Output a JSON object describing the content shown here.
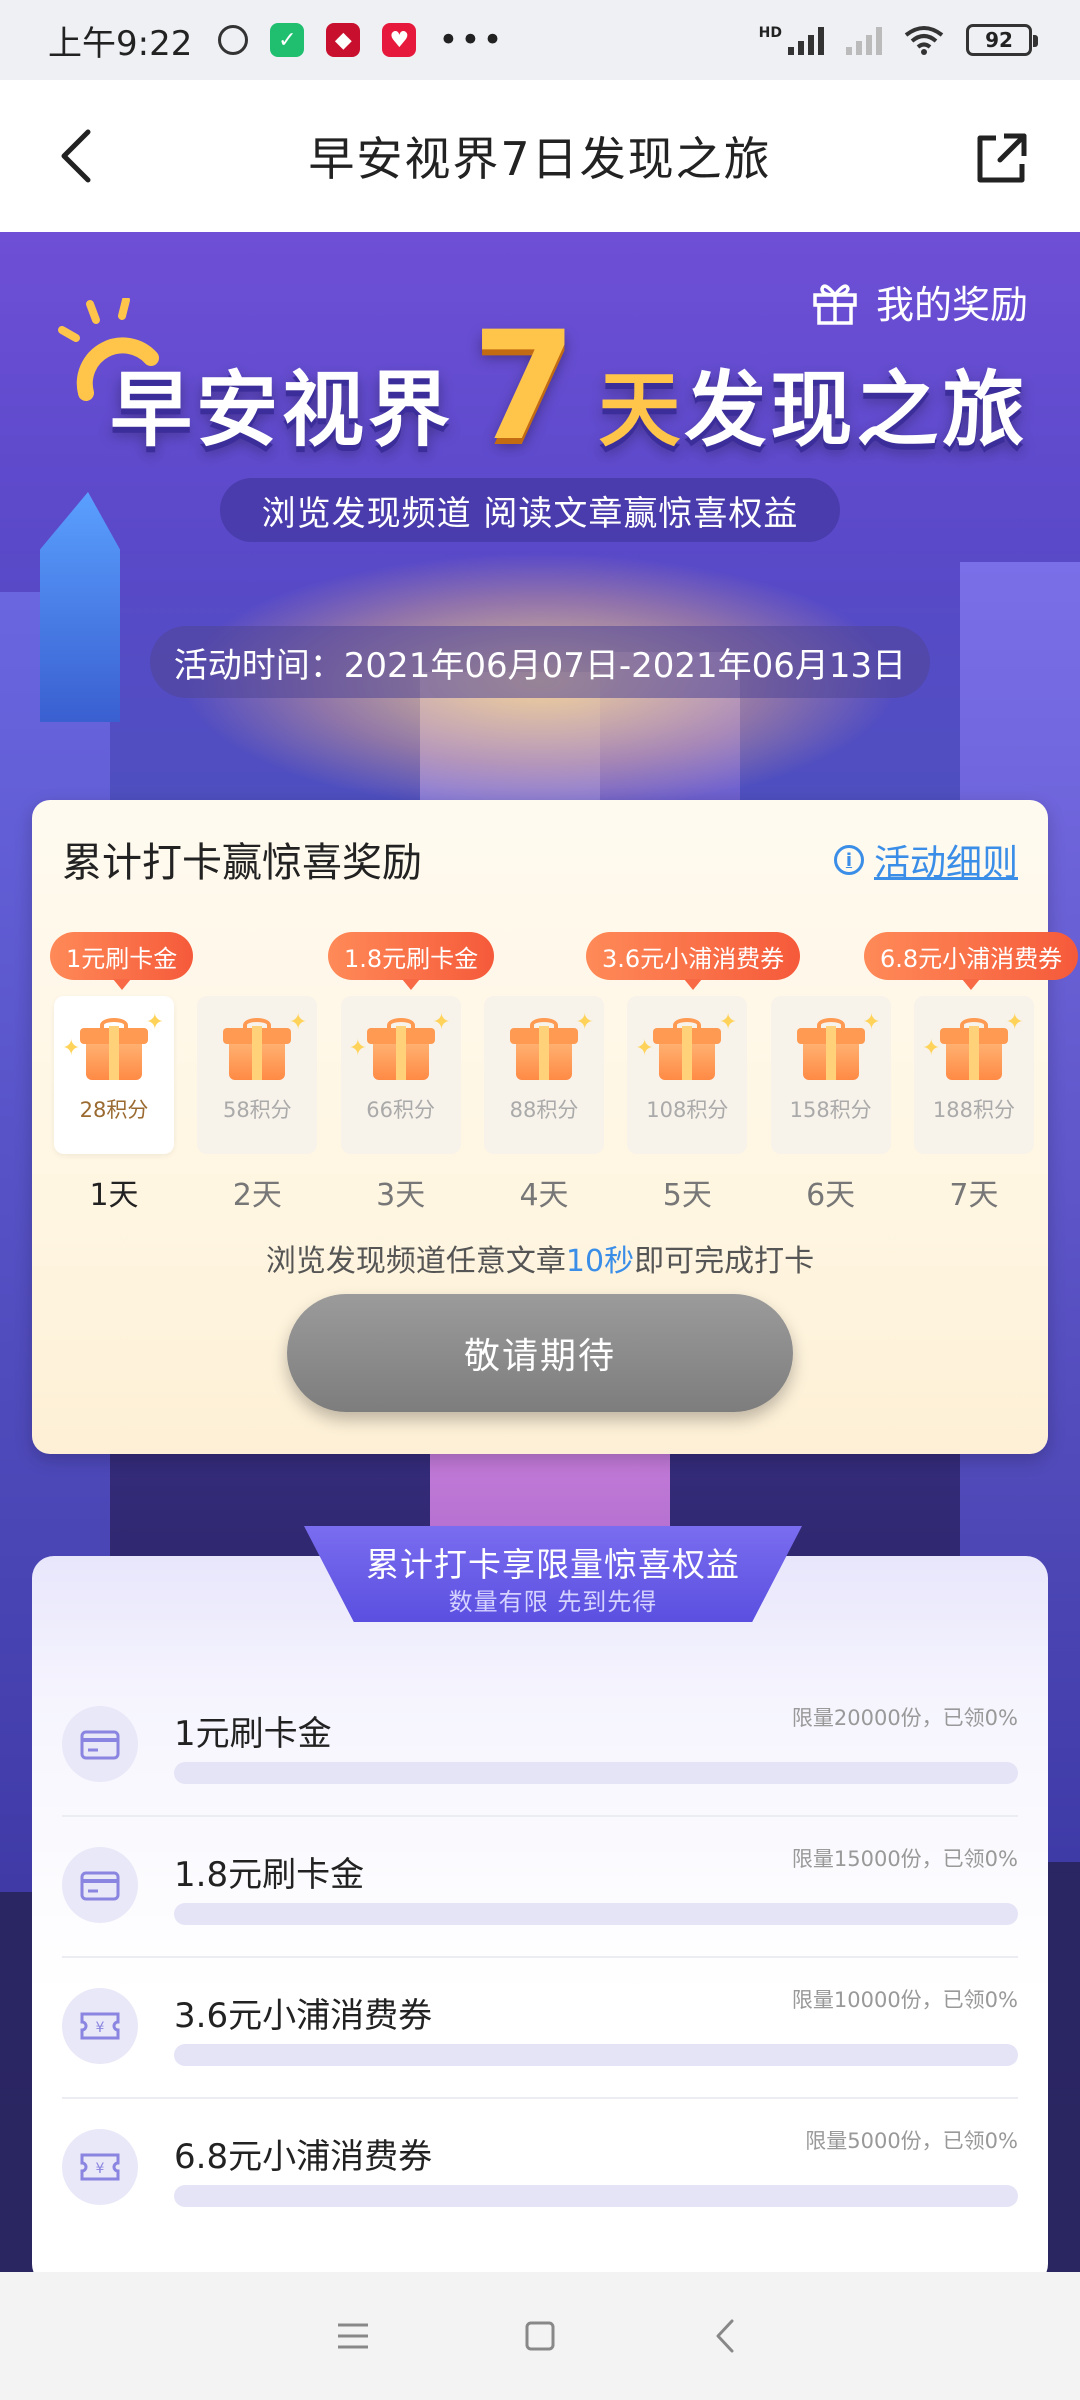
{
  "status_bar": {
    "time": "上午9:22",
    "battery": "92",
    "network": "HD",
    "app_icon_colors": [
      "#1fbf6f",
      "#c8102e",
      "#e6193c"
    ]
  },
  "header": {
    "title": "早安视界7日发现之旅",
    "back_icon": "back-arrow-icon",
    "share_icon": "share-icon"
  },
  "hero": {
    "my_rewards": "我的奖励",
    "title_prefix": "早安视界",
    "title_number": "7",
    "title_day": "天",
    "title_suffix": "发现之旅",
    "subtitle": "浏览发现频道  阅读文章赢惊喜权益",
    "period": "活动时间：2021年06月07日-2021年06月13日"
  },
  "checkin": {
    "title": "累计打卡赢惊喜奖励",
    "rules_link": "活动细则",
    "tags": [
      {
        "label": "1元刷卡金",
        "day": 1
      },
      {
        "label": "1.8元刷卡金",
        "day": 3
      },
      {
        "label": "3.6元小浦消费券",
        "day": 5
      },
      {
        "label": "6.8元小浦消费券",
        "day": 7
      }
    ],
    "days": [
      {
        "points": "28积分",
        "label": "1天",
        "active": true
      },
      {
        "points": "58积分",
        "label": "2天",
        "active": false
      },
      {
        "points": "66积分",
        "label": "3天",
        "active": false
      },
      {
        "points": "88积分",
        "label": "4天",
        "active": false
      },
      {
        "points": "108积分",
        "label": "5天",
        "active": false
      },
      {
        "points": "158积分",
        "label": "6天",
        "active": false
      },
      {
        "points": "188积分",
        "label": "7天",
        "active": false
      }
    ],
    "hint_before": "浏览发现频道任意文章",
    "hint_highlight": "10秒",
    "hint_after": "即可完成打卡",
    "button": "敬请期待",
    "accent": "#3a8ee8"
  },
  "benefits": {
    "title": "累计打卡享限量惊喜权益",
    "subtitle": "数量有限  先到先得",
    "items": [
      {
        "name": "1元刷卡金",
        "quota": "限量20000份，已领0%",
        "claimed": 0,
        "icon": "card-icon"
      },
      {
        "name": "1.8元刷卡金",
        "quota": "限量15000份，已领0%",
        "claimed": 0,
        "icon": "card-icon"
      },
      {
        "name": "3.6元小浦消费券",
        "quota": "限量10000份，已领0%",
        "claimed": 0,
        "icon": "coupon-icon"
      },
      {
        "name": "6.8元小浦消费券",
        "quota": "限量5000份，已领0%",
        "claimed": 0,
        "icon": "coupon-icon"
      }
    ]
  },
  "nav": {
    "menu_icon": "menu-icon",
    "home_icon": "home-icon",
    "back_icon": "back-icon"
  }
}
